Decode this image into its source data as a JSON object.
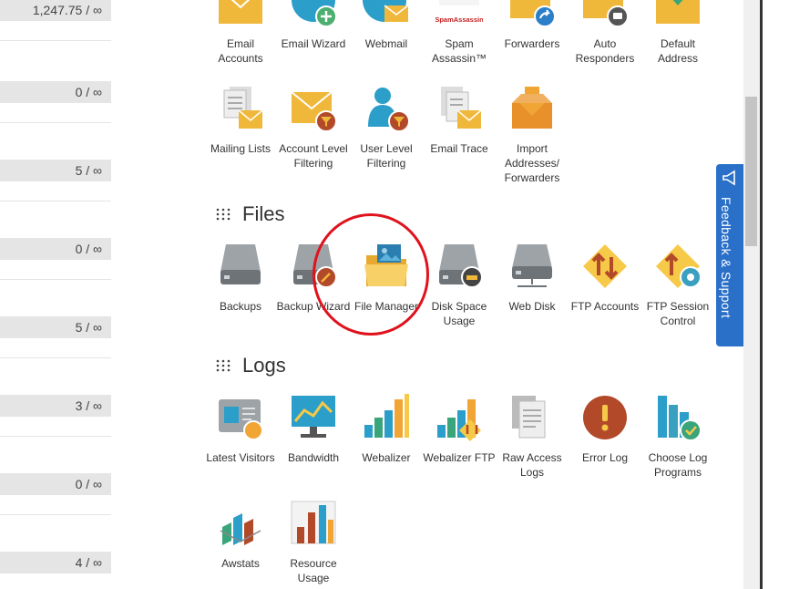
{
  "stats": [
    "1,247.75 / ∞",
    "0 / ∞",
    "5 / ∞",
    "0 / ∞",
    "5 / ∞",
    "3 / ∞",
    "0 / ∞",
    "4 / ∞"
  ],
  "email": {
    "row1": [
      "Email Accounts",
      "Email Wizard",
      "Webmail",
      "Spam Assassin™",
      "Forwarders",
      "Auto Responders",
      "Default Address"
    ],
    "row2": [
      "Mailing Lists",
      "Account Level Filtering",
      "User Level Filtering",
      "Email Trace",
      "Import Addresses/ Forwarders"
    ],
    "spamassassin_logo_text": "SpamAssassin"
  },
  "files": {
    "title": "Files",
    "items": [
      "Backups",
      "Backup Wizard",
      "File Manager",
      "Disk Space Usage",
      "Web Disk",
      "FTP Accounts",
      "FTP Session Control"
    ]
  },
  "logs": {
    "title": "Logs",
    "row1": [
      "Latest Visitors",
      "Bandwidth",
      "Webalizer",
      "Webalizer FTP",
      "Raw Access Logs",
      "Error Log",
      "Choose Log Programs"
    ],
    "row2": [
      "Awstats",
      "Resource Usage"
    ]
  },
  "feedback_label": "Feedback & Support",
  "colors": {
    "accent_orange": "#f0a534",
    "teal": "#2b9ec9",
    "red_annotation": "#e0121d",
    "feedback_blue": "#2a6fc8"
  }
}
